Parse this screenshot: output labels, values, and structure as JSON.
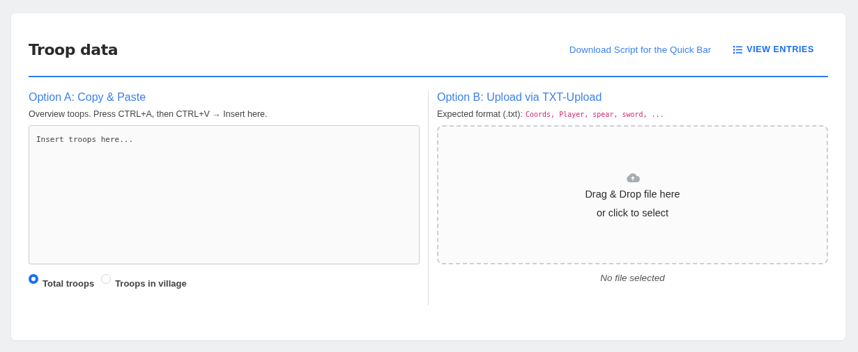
{
  "header": {
    "title": "Troop data",
    "download_link": "Download Script for the Quick Bar",
    "view_button": "VIEW ENTRIES"
  },
  "option_a": {
    "title": "Option A: Copy & Paste",
    "hint": "Overview toops. Press CTRL+A, then CTRL+V → Insert here.",
    "placeholder": "Insert troops here...",
    "radios": [
      {
        "label": "Total troops",
        "selected": true
      },
      {
        "label": "Troops in village",
        "selected": false
      }
    ]
  },
  "option_b": {
    "title": "Option B: Upload via TXT-Upload",
    "format_label": "Expected format (.txt):",
    "format_example": "Coords, Player, spear, sword, ...",
    "drop_line_1": "Drag & Drop file here",
    "drop_line_2": "or click to select",
    "status": "No file selected"
  }
}
